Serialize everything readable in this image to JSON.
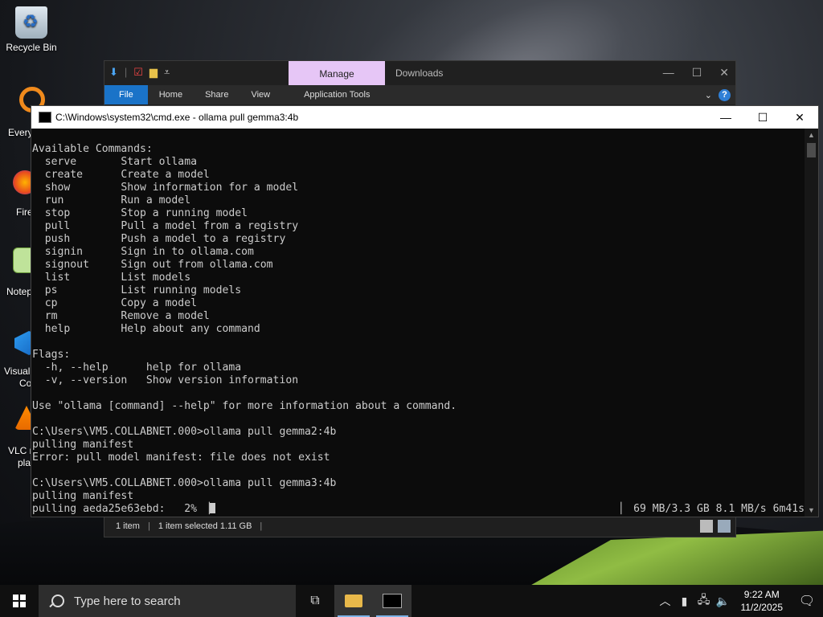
{
  "desktop": {
    "recycle_bin_label": "Recycle Bin",
    "partial_labels": [
      "Every",
      "Fire",
      "Notep",
      "Visual",
      "Co",
      "VLC r",
      "pla"
    ]
  },
  "explorer": {
    "manage_tab": "Manage",
    "title": "Downloads",
    "ribbon": {
      "file": "File",
      "home": "Home",
      "share": "Share",
      "view": "View",
      "app_tools": "Application Tools"
    },
    "status": {
      "items": "1 item",
      "selected": "1 item selected  1.11 GB",
      "sep": "|"
    }
  },
  "cmd": {
    "title": "C:\\Windows\\system32\\cmd.exe - ollama  pull gemma3:4b",
    "lines": [
      "Available Commands:",
      "  serve       Start ollama",
      "  create      Create a model",
      "  show        Show information for a model",
      "  run         Run a model",
      "  stop        Stop a running model",
      "  pull        Pull a model from a registry",
      "  push        Push a model to a registry",
      "  signin      Sign in to ollama.com",
      "  signout     Sign out from ollama.com",
      "  list        List models",
      "  ps          List running models",
      "  cp          Copy a model",
      "  rm          Remove a model",
      "  help        Help about any command",
      "",
      "Flags:",
      "  -h, --help      help for ollama",
      "  -v, --version   Show version information",
      "",
      "Use \"ollama [command] --help\" for more information about a command.",
      "",
      "C:\\Users\\VM5.COLLABNET.000>ollama pull gemma2:4b",
      "pulling manifest",
      "Error: pull model manifest: file does not exist",
      "",
      "C:\\Users\\VM5.COLLABNET.000>ollama pull gemma3:4b",
      "pulling manifest"
    ],
    "progress_line_left": "pulling aeda25e63ebd:   2% ▕",
    "progress_line_right": "▏  69 MB/3.3 GB  8.1 MB/s   6m41s",
    "progress_percent": 2
  },
  "taskbar": {
    "search_placeholder": "Type here to search",
    "time": "9:22 AM",
    "date": "11/2/2025"
  }
}
